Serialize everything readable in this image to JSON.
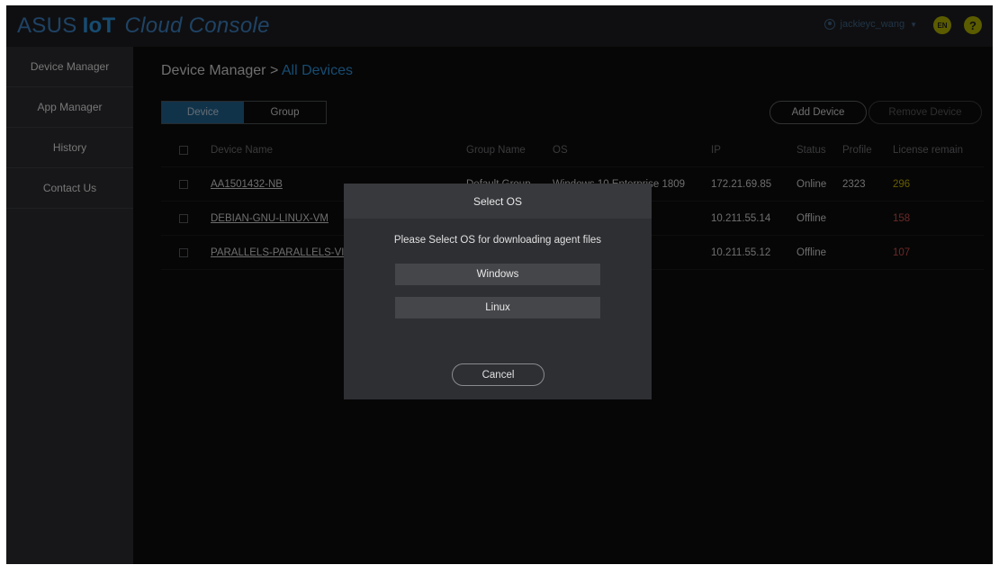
{
  "header": {
    "logo_brand": "ASUS",
    "logo_iot": "IoT",
    "logo_product": "Cloud Console",
    "username": "jackieyc_wang",
    "lang_label": "EN",
    "help_label": "?",
    "accent_color": "#2a8ad0"
  },
  "sidebar": {
    "items": [
      {
        "label": "Device Manager"
      },
      {
        "label": "App Manager"
      },
      {
        "label": "History"
      },
      {
        "label": "Contact Us"
      }
    ]
  },
  "main": {
    "breadcrumb_root": "Device Manager >",
    "breadcrumb_current": "All Devices",
    "tabs": [
      {
        "label": "Device",
        "active": true
      },
      {
        "label": "Group",
        "active": false
      }
    ],
    "add_device_label": "Add Device",
    "remove_device_label": "Remove Device"
  },
  "table": {
    "columns": [
      "Device Name",
      "Group Name",
      "OS",
      "IP",
      "Status",
      "Profile",
      "License remain"
    ],
    "rows": [
      {
        "name": "AA1501432-NB",
        "group": "Default Group",
        "os": "Windows 10 Enterprise 1809",
        "ip": "172.21.69.85",
        "status": "Online",
        "profile": "2323",
        "license": "296"
      },
      {
        "name": "DEBIAN-GNU-LINUX-VM",
        "group": "",
        "os": "",
        "ip": "10.211.55.14",
        "status": "Offline",
        "profile": "",
        "license": "158"
      },
      {
        "name": "PARALLELS-PARALLELS-VIRTUAL-PLATFORM",
        "group": "",
        "os": "",
        "ip": "10.211.55.12",
        "status": "Offline",
        "profile": "",
        "license": "107"
      }
    ]
  },
  "modal": {
    "title": "Select OS",
    "message": "Please Select OS for downloading agent files",
    "windows_label": "Windows",
    "linux_label": "Linux",
    "cancel_label": "Cancel"
  }
}
